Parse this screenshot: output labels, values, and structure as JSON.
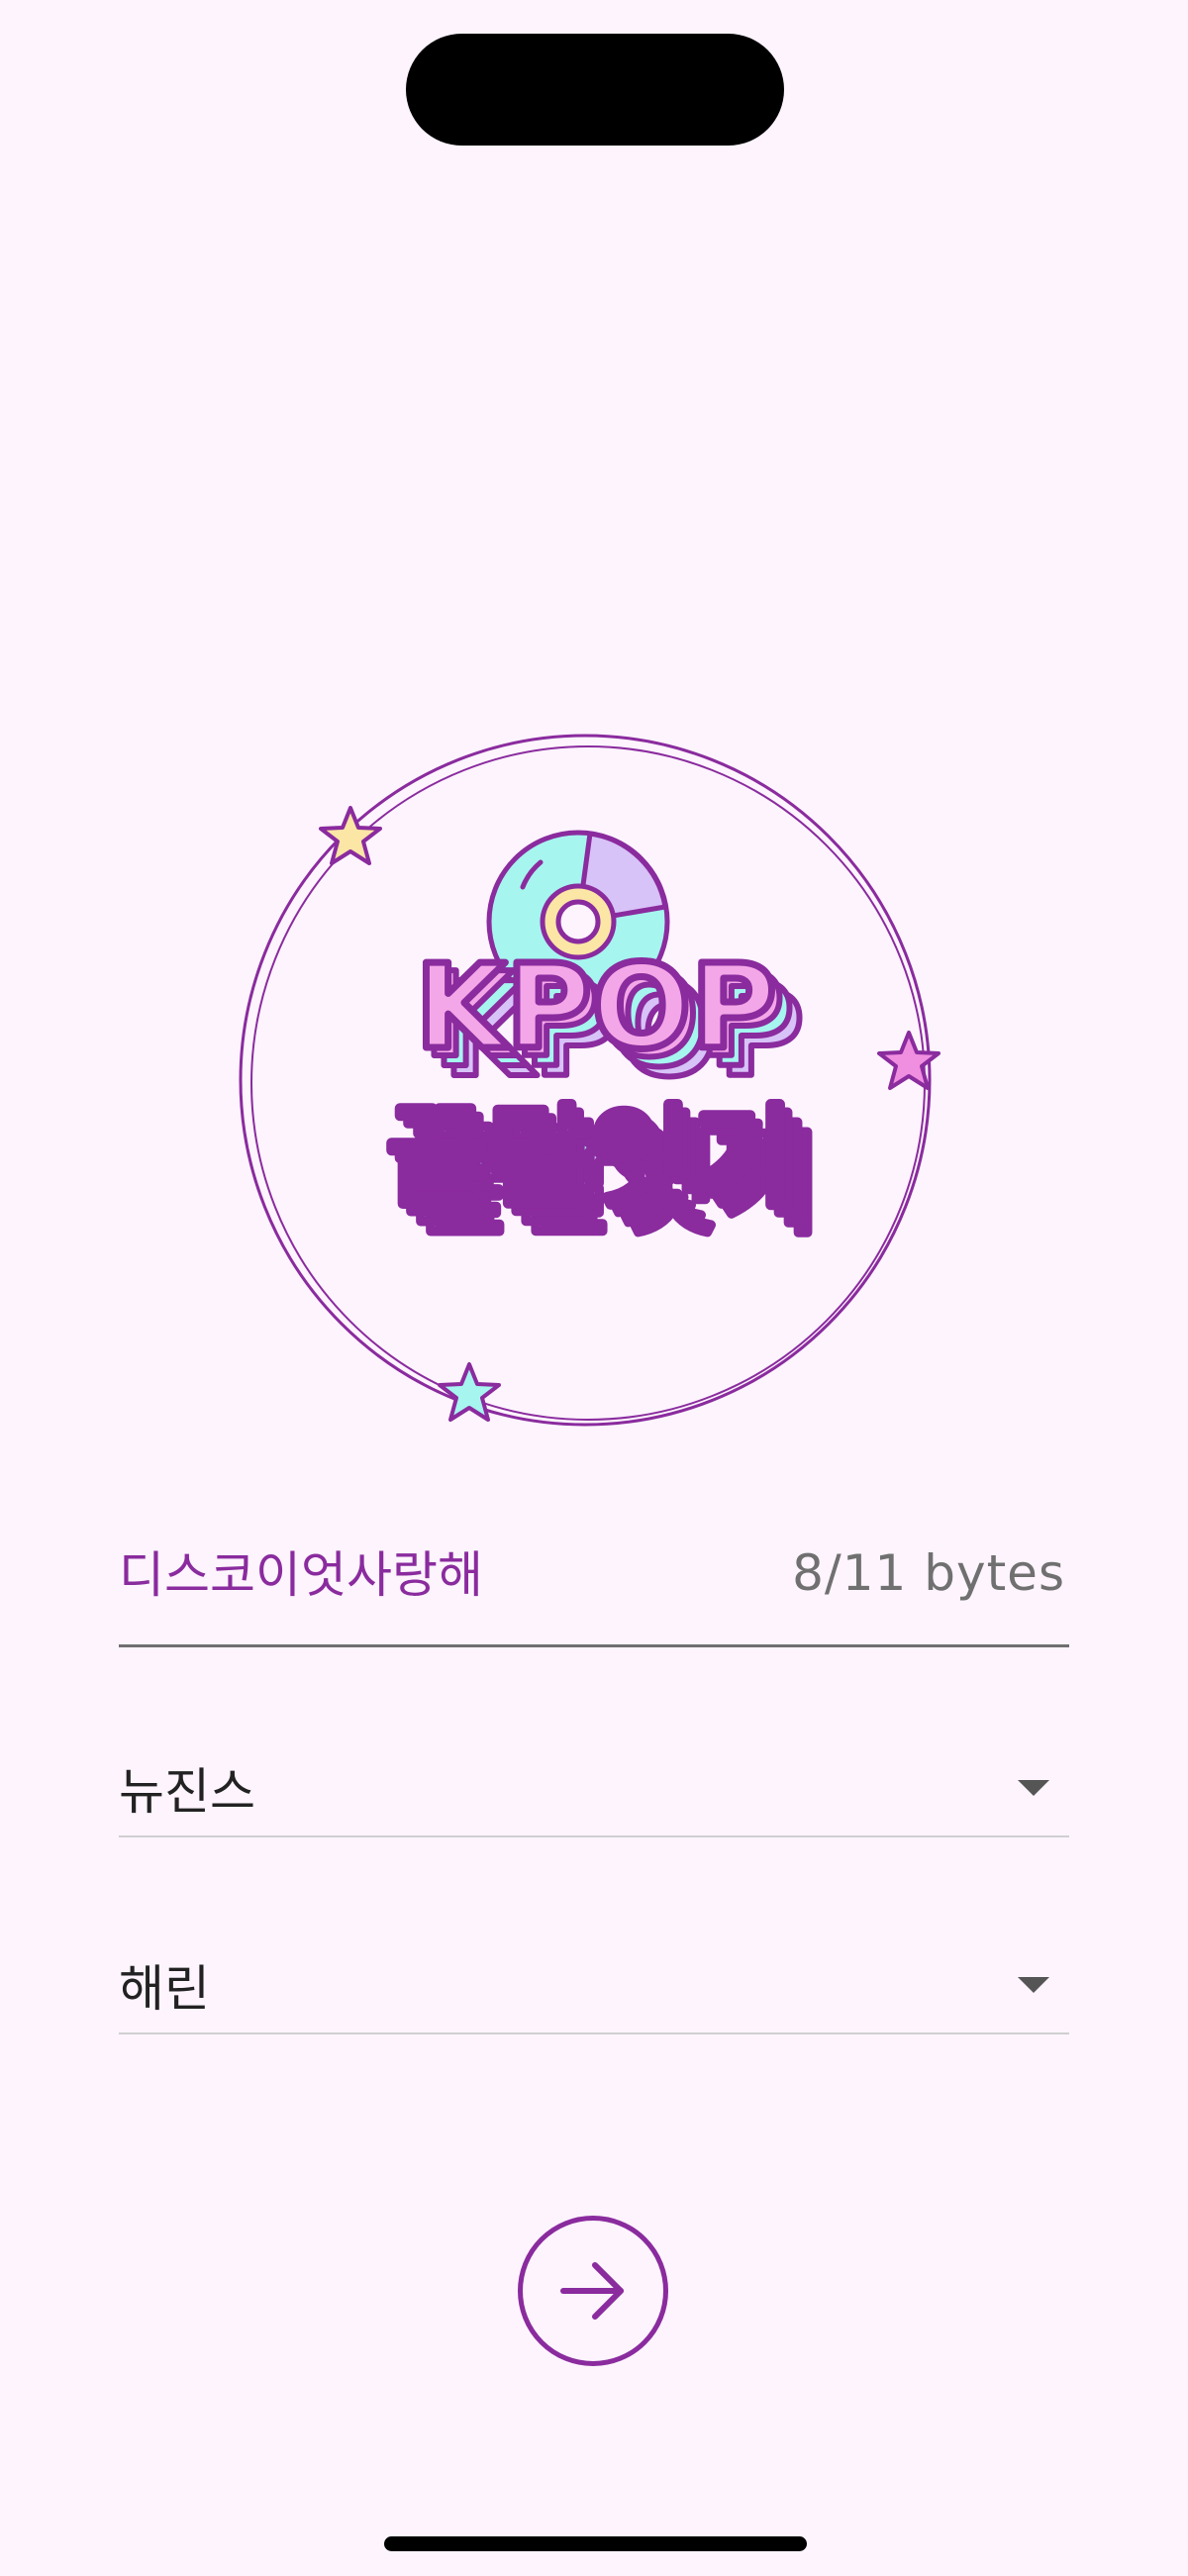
{
  "logo": {
    "line1": "KPOP",
    "line2": "끝말잇기"
  },
  "nickname": {
    "value": "디스코이엇사랑해",
    "byte_count": "8/11 bytes"
  },
  "group_select": {
    "selected": "뉴진스"
  },
  "member_select": {
    "selected": "해린"
  },
  "colors": {
    "accent": "#8a2b9e",
    "background": "#fdf4fd",
    "logo_pink": "#f4a7e8",
    "logo_cyan": "#a6f5ef",
    "logo_lavender": "#d7c3f7",
    "star_yellow": "#fbe6a6"
  },
  "icons": {
    "next": "arrow-right-icon"
  }
}
